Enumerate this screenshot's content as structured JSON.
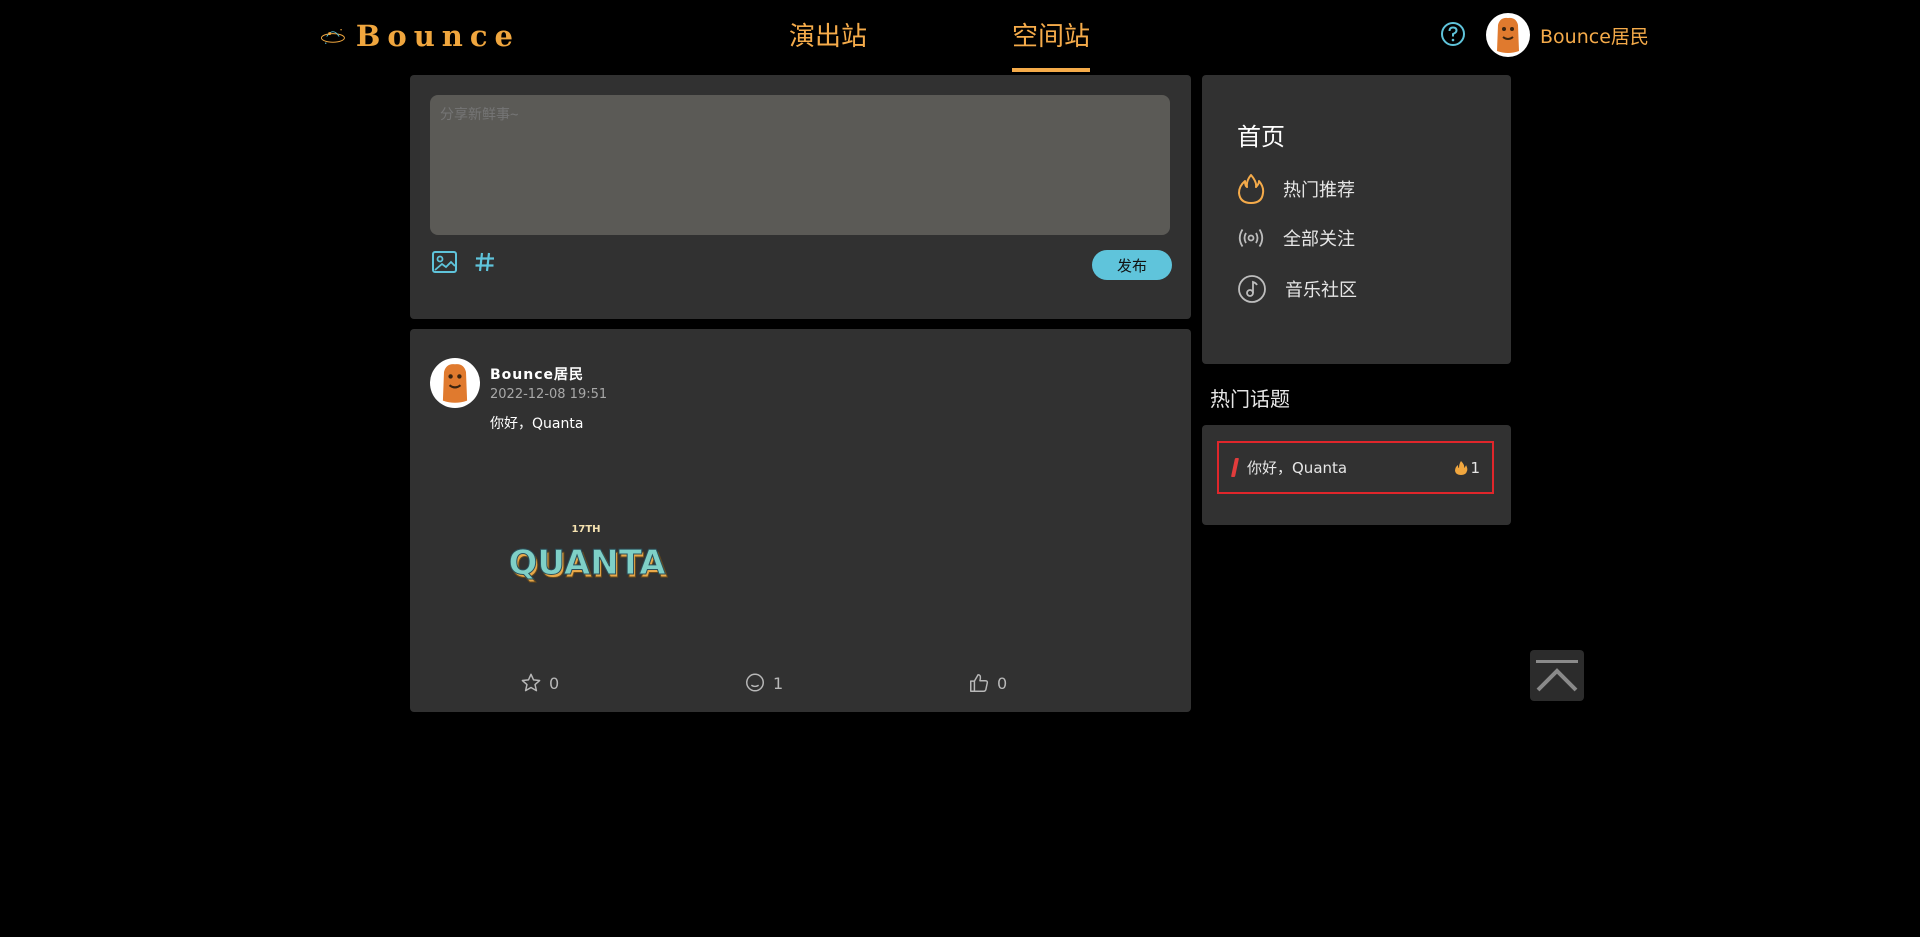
{
  "header": {
    "logo_text": "Bounce",
    "tabs": [
      {
        "label": "演出站",
        "active": false
      },
      {
        "label": "空间站",
        "active": true
      }
    ],
    "username": "Bounce居民"
  },
  "composer": {
    "placeholder": "分享新鲜事~",
    "publish_label": "发布",
    "tools": [
      "image-icon",
      "hashtag-icon"
    ]
  },
  "post": {
    "author": "Bounce居民",
    "time": "2022-12-08 19:51",
    "content": "你好，Quanta",
    "image_text": "QUANTA",
    "image_badge": "17TH",
    "favorites": "0",
    "comments": "1",
    "likes": "0"
  },
  "sidebar": {
    "title": "首页",
    "items": [
      {
        "label": "热门推荐",
        "icon": "flame-icon"
      },
      {
        "label": "全部关注",
        "icon": "broadcast-icon"
      },
      {
        "label": "音乐社区",
        "icon": "music-disc-icon"
      }
    ],
    "hot_topics_title": "热门话题",
    "hot_topics": [
      {
        "label": "你好，Quanta",
        "count": "1"
      }
    ]
  },
  "colors": {
    "accent": "#f5ab4a",
    "panel": "#313131",
    "input_bg": "#5b5a56",
    "publish": "#5fc4db",
    "highlight_border": "#e0262b"
  }
}
